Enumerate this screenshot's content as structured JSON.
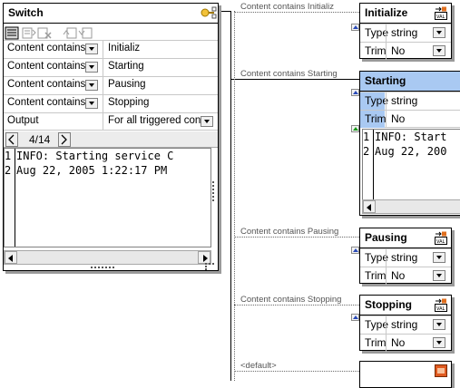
{
  "switch": {
    "title": "Switch",
    "conditions": [
      {
        "type": "Content contains",
        "value": "Initializ"
      },
      {
        "type": "Content contains",
        "value": "Starting"
      },
      {
        "type": "Content contains",
        "value": "Pausing"
      },
      {
        "type": "Content contains",
        "value": "Stopping"
      }
    ],
    "output_label": "Output",
    "output_value": "For all triggered con...",
    "pager": "4/14",
    "console_lines": [
      {
        "num": "1",
        "text": "INFO: Starting service C"
      },
      {
        "num": "2",
        "text": "Aug 22, 2005 1:22:17 PM"
      }
    ]
  },
  "connectors": {
    "c1": "Content contains Initializ",
    "c2": "Content contains Starting",
    "c3": "Content contains Pausing",
    "c4": "Content contains Stopping",
    "default": "<default>"
  },
  "components": [
    {
      "title": "Initialize",
      "type_label": "Type",
      "type_value": "string",
      "trim_label": "Trim",
      "trim_value": "No"
    },
    {
      "title": "Starting",
      "type_label": "Type",
      "type_value": "string",
      "trim_label": "Trim",
      "trim_value": "No",
      "console_lines": [
        {
          "num": "1",
          "text": "INFO: Start"
        },
        {
          "num": "2",
          "text": "Aug 22, 200"
        }
      ]
    },
    {
      "title": "Pausing",
      "type_label": "Type",
      "type_value": "string",
      "trim_label": "Trim",
      "trim_value": "No"
    },
    {
      "title": "Stopping",
      "type_label": "Type",
      "type_value": "string",
      "trim_label": "Trim",
      "trim_value": "No"
    }
  ],
  "colors": {
    "selection": "#a9c9f2",
    "port_blue": "#2a4ab8",
    "port_green": "#1a9a1a"
  }
}
